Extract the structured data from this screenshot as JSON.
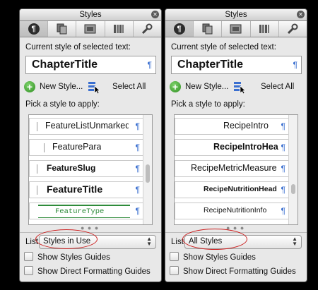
{
  "panels": [
    {
      "title": "Styles",
      "current_label": "Current style of selected text:",
      "current_style": "ChapterTitle",
      "new_style_label": "New Style...",
      "select_all_label": "Select All",
      "pick_label": "Pick a style to apply:",
      "styles": [
        "FeatureListUnmarked",
        "FeaturePara",
        "FeatureSlug",
        "FeatureTitle",
        "FeatureType"
      ],
      "list_label": "List:",
      "list_value": "Styles in Use",
      "options": [
        "Show Styles Guides",
        "Show Direct Formatting Guides"
      ]
    },
    {
      "title": "Styles",
      "current_label": "Current style of selected text:",
      "current_style": "ChapterTitle",
      "new_style_label": "New Style...",
      "select_all_label": "Select All",
      "pick_label": "Pick a style to apply:",
      "styles": [
        "RecipeIntro",
        "RecipeIntroHead",
        "RecipeMetricMeasure",
        "RecipeNutritionHead",
        "RecipeNutritionInfo"
      ],
      "list_label": "List:",
      "list_value": "All Styles",
      "options": [
        "Show Styles Guides",
        "Show Direct Formatting Guides"
      ]
    }
  ],
  "pilcrow": "¶",
  "icons": [
    "paragraph-styles-icon",
    "page-styles-icon",
    "picture-styles-icon",
    "library-icon",
    "wrench-icon"
  ]
}
